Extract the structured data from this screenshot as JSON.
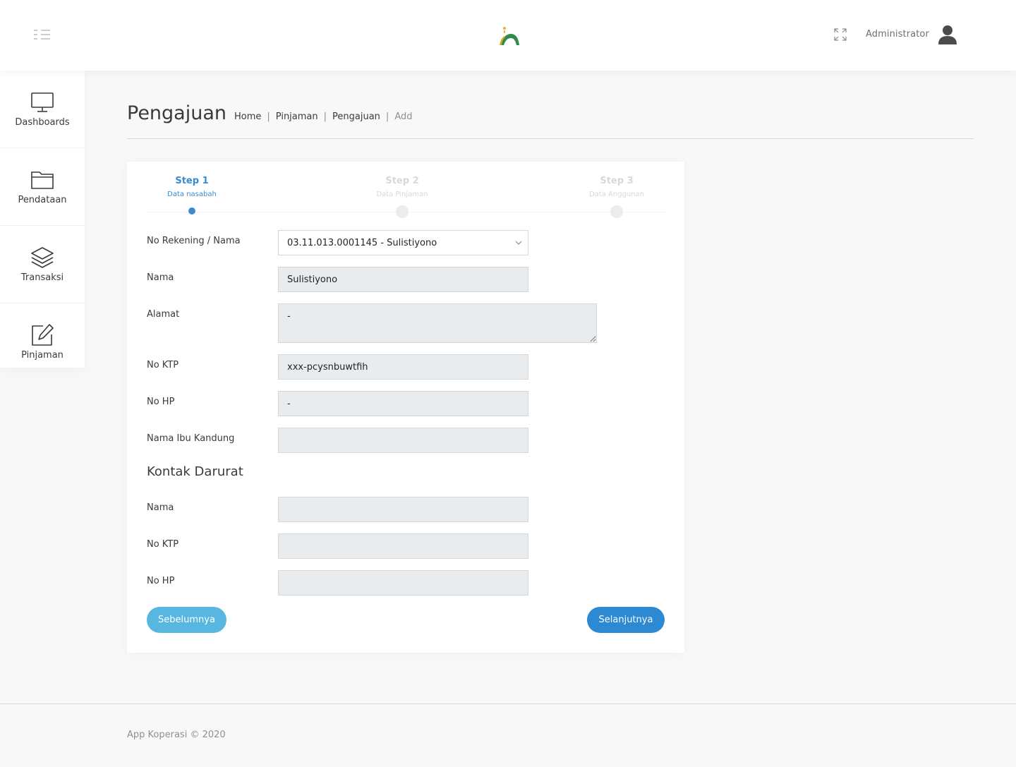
{
  "topbar": {
    "user_name": "Administrator"
  },
  "sidebar": {
    "items": [
      {
        "label": "Dashboards",
        "icon": "monitor-icon"
      },
      {
        "label": "Pendataan",
        "icon": "folder-icon"
      },
      {
        "label": "Transaksi",
        "icon": "layers-icon"
      },
      {
        "label": "Pinjaman",
        "icon": "edit-icon"
      }
    ]
  },
  "page": {
    "title": "Pengajuan",
    "breadcrumb": [
      "Home",
      "Pinjaman",
      "Pengajuan",
      "Add"
    ],
    "breadcrumb_sep": "|"
  },
  "wizard": {
    "steps": [
      {
        "title": "Step 1",
        "subtitle": "Data nasabah",
        "state": "active"
      },
      {
        "title": "Step 2",
        "subtitle": "Data Pinjaman",
        "state": "inactive"
      },
      {
        "title": "Step 3",
        "subtitle": "Data Anggunan",
        "state": "inactive"
      }
    ]
  },
  "form": {
    "no_rekening": {
      "label": "No Rekening / Nama",
      "value": "03.11.013.0001145 - Sulistiyono"
    },
    "nama": {
      "label": "Nama",
      "value": "Sulistiyono"
    },
    "alamat": {
      "label": "Alamat",
      "value": "-"
    },
    "no_ktp": {
      "label": "No KTP",
      "value": "xxx-pcysnbuwtfih"
    },
    "no_hp": {
      "label": "No HP",
      "value": "-"
    },
    "nama_ibu": {
      "label": "Nama Ibu Kandung",
      "value": ""
    }
  },
  "emergency": {
    "title": "Kontak Darurat",
    "nama": {
      "label": "Nama",
      "value": ""
    },
    "no_ktp": {
      "label": "No KTP",
      "value": ""
    },
    "no_hp": {
      "label": "No HP",
      "value": ""
    }
  },
  "buttons": {
    "prev": "Sebelumnya",
    "next": "Selanjutnya"
  },
  "footer": {
    "text": "App Koperasi © 2020"
  },
  "colors": {
    "primary": "#2d8ad2",
    "secondary": "#58b7e1",
    "active_step": "#3a8ad0"
  }
}
